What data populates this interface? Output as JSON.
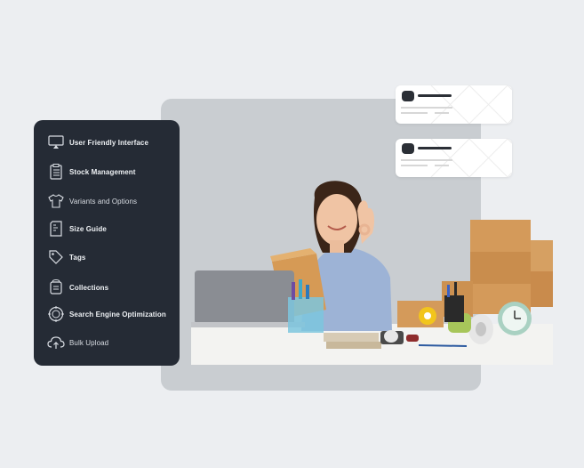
{
  "menu": {
    "items": [
      {
        "label": "User Friendly Interface",
        "icon": "monitor-icon"
      },
      {
        "label": "Stock Management",
        "icon": "clipboard-list-icon"
      },
      {
        "label": "Variants and Options",
        "icon": "shirt-icon"
      },
      {
        "label": "Size Guide",
        "icon": "size-chart-icon"
      },
      {
        "label": "Tags",
        "icon": "tag-icon"
      },
      {
        "label": "Collections",
        "icon": "collection-icon"
      },
      {
        "label": "Search Engine Optimization",
        "icon": "seo-icon"
      },
      {
        "label": "Bulk Upload",
        "icon": "cloud-upload-icon"
      }
    ]
  },
  "colors": {
    "background": "#eceef1",
    "menu_bg": "#252b35",
    "menu_text": "#d9dde3",
    "backdrop": "#c9cdd1",
    "card_bg": "#ffffff"
  }
}
